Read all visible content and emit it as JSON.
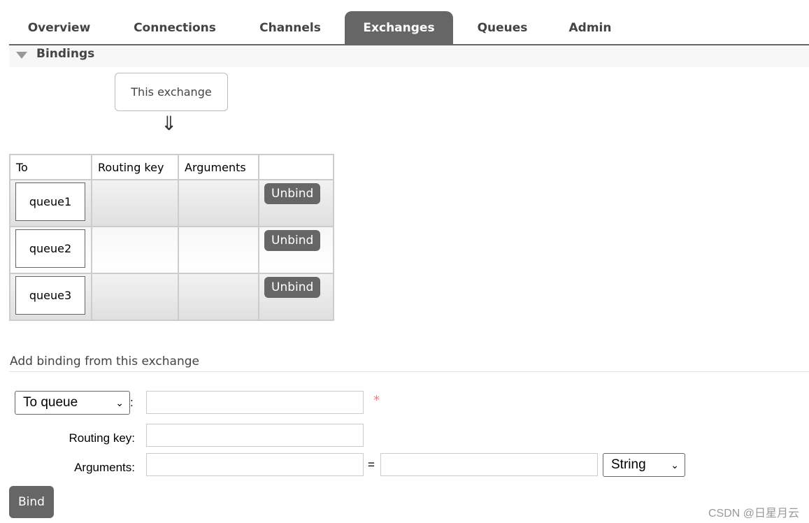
{
  "nav": {
    "tabs": [
      {
        "label": "Overview",
        "active": false
      },
      {
        "label": "Connections",
        "active": false
      },
      {
        "label": "Channels",
        "active": false
      },
      {
        "label": "Exchanges",
        "active": true
      },
      {
        "label": "Queues",
        "active": false
      },
      {
        "label": "Admin",
        "active": false
      }
    ]
  },
  "bindings": {
    "title": "Bindings",
    "source_label": "This exchange",
    "arrow": "⇓",
    "columns": [
      "To",
      "Routing key",
      "Arguments",
      ""
    ],
    "rows": [
      {
        "to": "queue1",
        "routing_key": "",
        "arguments": "",
        "action": "Unbind"
      },
      {
        "to": "queue2",
        "routing_key": "",
        "arguments": "",
        "action": "Unbind"
      },
      {
        "to": "queue3",
        "routing_key": "",
        "arguments": "",
        "action": "Unbind"
      }
    ]
  },
  "add_binding": {
    "title": "Add binding from this exchange",
    "destination_type": "To queue",
    "colon": ":",
    "required_mark": "*",
    "routing_key_label": "Routing key:",
    "arguments_label": "Arguments:",
    "equals": "=",
    "arg_type": "String",
    "bind_label": "Bind",
    "destination_value": "",
    "routing_key_value": "",
    "arg_key_value": "",
    "arg_value_value": ""
  },
  "watermark": "CSDN @日星月云"
}
